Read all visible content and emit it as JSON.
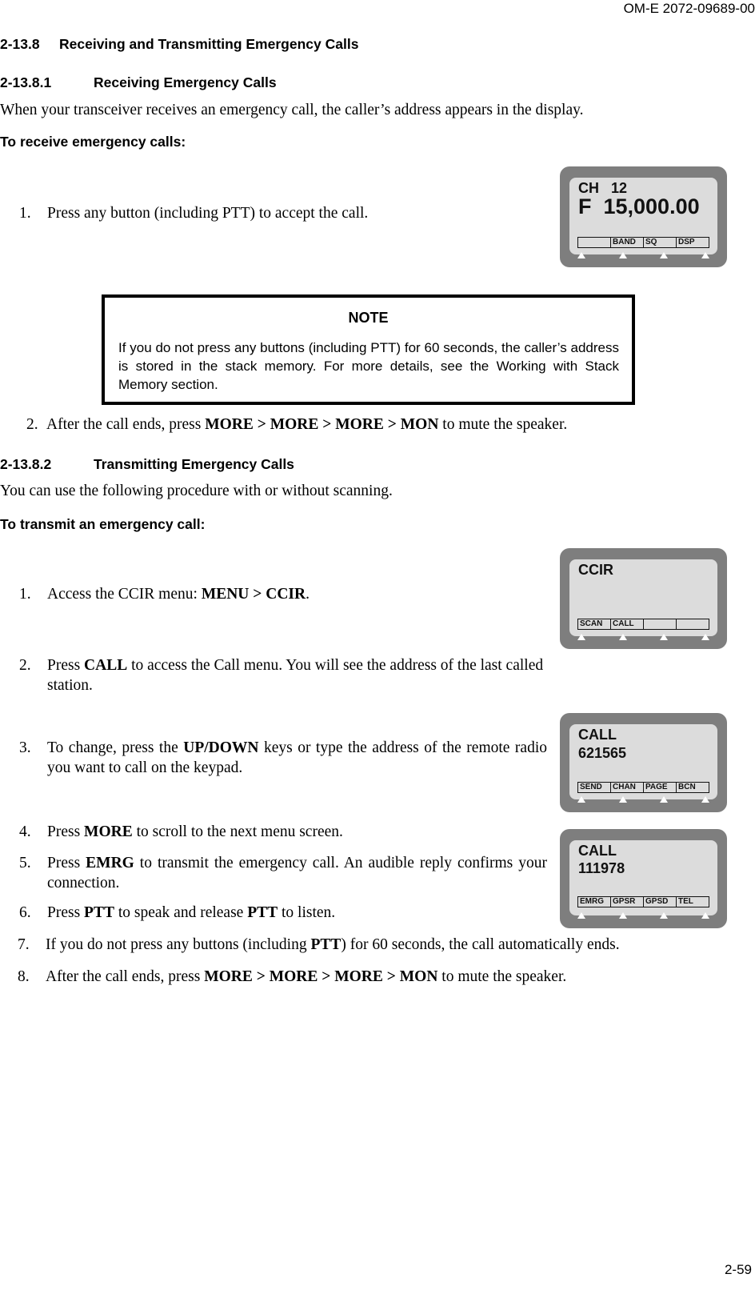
{
  "header": {
    "doc_id": "OM-E 2072-09689-00"
  },
  "section": {
    "number": "2-13.8",
    "title": "Receiving and Transmitting Emergency Calls"
  },
  "receiving": {
    "number": "2-13.8.1",
    "title": "Receiving Emergency Calls",
    "intro": "When your transceiver receives an emergency call, the caller’s address appears in the display.",
    "procedure_title": "To receive emergency calls:",
    "step1": {
      "n": "1.",
      "text": "Press any button (including PTT) to accept the call."
    },
    "note": {
      "title": "NOTE",
      "body": "If you do not press any buttons (including PTT) for 60 seconds, the caller’s address is stored in the stack memory. For more details, see the Working with Stack Memory section."
    },
    "step2": {
      "n": "2.",
      "pre": "After the call ends, press ",
      "bold": "MORE > MORE > MORE > MON",
      "post": " to mute the speaker."
    }
  },
  "transmitting": {
    "number": "2-13.8.2",
    "title": "Transmitting Emergency Calls",
    "intro": "You can use the following procedure with or without scanning.",
    "procedure_title": "To transmit an emergency call:",
    "steps": [
      {
        "n": "1.",
        "pre": "Access the CCIR menu: ",
        "bold": "MENU > CCIR",
        "post": "."
      },
      {
        "n": "2.",
        "pre": "Press ",
        "bold": "CALL",
        "post": " to access the Call menu. You will see the address of the last called station."
      },
      {
        "n": "3.",
        "pre": "To change, press the ",
        "bold": "UP/DOWN",
        "post": " keys or type the address of the remote radio you want to call on the keypad."
      },
      {
        "n": "4.",
        "pre": "Press ",
        "bold": "MORE",
        "post": " to scroll to the next menu screen."
      },
      {
        "n": "5.",
        "pre": "Press ",
        "bold": "EMRG",
        "post": " to transmit the emergency call. An audible reply confirms your connection."
      },
      {
        "n": "6.",
        "pre": "Press ",
        "bold": "PTT",
        "mid": " to speak and release ",
        "bold2": "PTT",
        "post": " to listen."
      },
      {
        "n": "7.",
        "pre": "If you do not press any buttons (including ",
        "bold": "PTT",
        "post": ") for 60 seconds, the call automatically ends."
      },
      {
        "n": "8.",
        "pre": "After the call ends, press ",
        "bold": "MORE > MORE > MORE > MON",
        "post": " to mute the speaker."
      }
    ]
  },
  "displays": [
    {
      "line1": "CH   12",
      "line2": "F  15,000.00",
      "keys": [
        "",
        "BAND",
        "SQ",
        "DSP"
      ]
    },
    {
      "line1": "CCIR",
      "line2": "",
      "keys": [
        "SCAN",
        "CALL",
        "",
        ""
      ]
    },
    {
      "line1": "CALL",
      "line2": "621565",
      "keys": [
        "SEND",
        "CHAN",
        "PAGE",
        "BCN"
      ]
    },
    {
      "line1": "CALL",
      "line2": "111978",
      "keys": [
        "EMRG",
        "GPSR",
        "GPSD",
        "TEL"
      ]
    }
  ],
  "footer": {
    "page_number": "2-59"
  }
}
